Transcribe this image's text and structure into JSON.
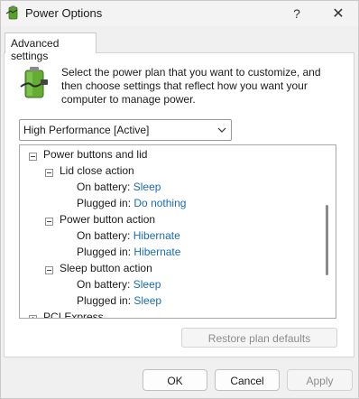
{
  "window": {
    "title": "Power Options",
    "help_label": "?",
    "close_label": "✕"
  },
  "tab": {
    "label": "Advanced settings"
  },
  "description": "Select the power plan that you want to customize, and then choose settings that reflect how you want your computer to manage power.",
  "plan_select": {
    "value": "High Performance [Active]"
  },
  "tree": {
    "root": "Power buttons and lid",
    "groups": [
      {
        "label": "Lid close action",
        "on_battery_label": "On battery:",
        "on_battery_value": "Sleep",
        "plugged_in_label": "Plugged in:",
        "plugged_in_value": "Do nothing"
      },
      {
        "label": "Power button action",
        "on_battery_label": "On battery:",
        "on_battery_value": "Hibernate",
        "plugged_in_label": "Plugged in:",
        "plugged_in_value": "Hibernate"
      },
      {
        "label": "Sleep button action",
        "on_battery_label": "On battery:",
        "on_battery_value": "Sleep",
        "plugged_in_label": "Plugged in:",
        "plugged_in_value": "Sleep"
      }
    ],
    "next_item": "PCI Express"
  },
  "buttons": {
    "restore": "Restore plan defaults",
    "ok": "OK",
    "cancel": "Cancel",
    "apply": "Apply"
  },
  "colors": {
    "value_link": "#1a6bb5",
    "disabled_text": "#8c8c8c"
  }
}
